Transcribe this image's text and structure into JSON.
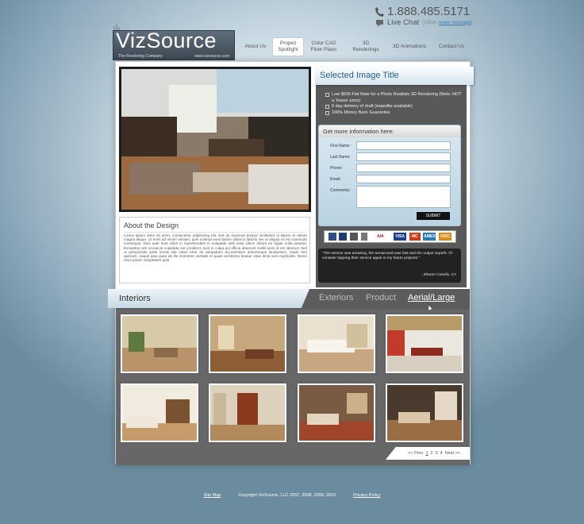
{
  "header": {
    "phone": "1.888.485.5171",
    "live_chat": "Live Chat",
    "live_chat_sub": "(Office,",
    "live_chat_link": "leave message)"
  },
  "logo": {
    "name": "VizSource",
    "tagline": "The Rendering Company",
    "url": "www.vizsource.com"
  },
  "nav": {
    "items": [
      {
        "label": "About Us"
      },
      {
        "label": "Project Spotlight"
      },
      {
        "label": "Color CAD Floor Plans"
      },
      {
        "label": "3D Renderings"
      },
      {
        "label": "3D Animations"
      },
      {
        "label": "Contact Us"
      }
    ]
  },
  "selected": {
    "title": "Selected Image Title",
    "features": [
      "Low $695 Flat Rate for a Photo Realistic 3D Rendering (Note: NOT a Teaser price)",
      "5 day delivery of draft (expedite available)",
      "100% Money Back Guarantee"
    ]
  },
  "about": {
    "title": "About the Design",
    "body": "Lorem ipsum dolor sit amet, consectetur adipisicing elit, sed do eiusmod tempor incididunt ut labore et dolore magna aliqua. Ut enim ad minim veniam, quis nostrud exercitation ullamco laboris nisi ut aliquip ex ea commodo consequat. Duis aute irure dolor in reprehenderit in voluptate velit esse cillum dolore eu fugiat nulla pariatur. Excepteur sint occaecat cupidatat non proident, sunt in culpa qui officia deserunt mollit anim id est laborum Sed ut perspiciatis unde omnis iste natus error sit voluptatem accusantium doloremque laudantium, totam rem aperiam, eaque ipsa quae ab illo inventore veritatis et quasi architecto beatae vitae dicta sunt explicabo. Nemo enim ipsam voluptatem quia"
  },
  "form": {
    "heading": "Get more information here:",
    "fields": [
      {
        "label": "First Name:"
      },
      {
        "label": "Last Name:"
      },
      {
        "label": "Phone:"
      },
      {
        "label": "Email:"
      },
      {
        "label": "Comments:"
      }
    ],
    "submit": "SUBMIT"
  },
  "badges": [
    "AIA",
    "VISA",
    "MC",
    "AMEX",
    "DISC"
  ],
  "testimonial": {
    "text": "\"The service was amazing, the turnaround was fast and the output superb. I'll consider tapping their service again in my future projects.\"",
    "author": "- Sharon Cunefa, CA"
  },
  "gallery": {
    "active_tab": "Interiors",
    "tabs": [
      "Exteriors",
      "Product",
      "Aerial/Large"
    ],
    "pager": {
      "prev": "<< Prev",
      "pages": [
        "1",
        "2",
        "3",
        "4"
      ],
      "next": "Next >>"
    }
  },
  "footer": {
    "site_map": "Site Map",
    "copyright": "Copyright VizSource, LLC 2007, 2008, 2009, 2010",
    "privacy": "Privacy Policy"
  }
}
